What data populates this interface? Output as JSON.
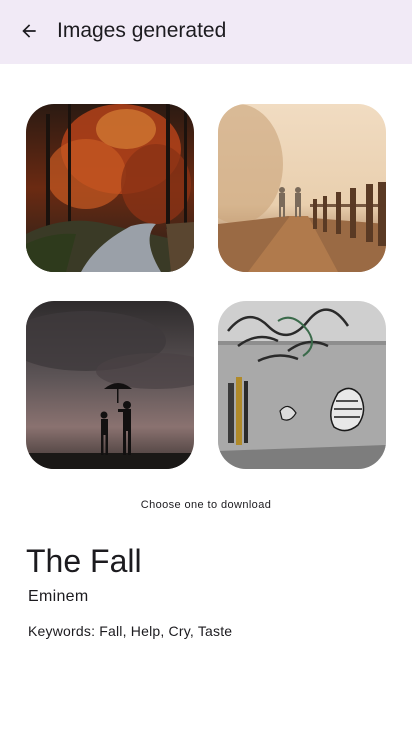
{
  "app_bar": {
    "title": "Images generated",
    "back_icon": "arrow-back-icon"
  },
  "images": [
    {
      "description_icon": "autumn-forest-road-image"
    },
    {
      "description_icon": "foggy-path-runners-image"
    },
    {
      "description_icon": "silhouette-umbrella-children-image"
    },
    {
      "description_icon": "graffiti-wall-image"
    }
  ],
  "hint": "Choose one to download",
  "song": {
    "title": "The Fall",
    "artist": "Eminem",
    "keywords": "Keywords: Fall, Help, Cry, Taste"
  },
  "colors": {
    "app_bar_bg": "#f1eaf6",
    "text": "#1c1b1f"
  }
}
